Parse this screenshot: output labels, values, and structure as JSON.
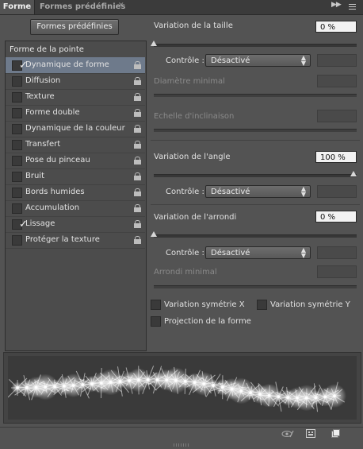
{
  "tabs": {
    "active": "Forme",
    "inactive": "Formes prédéfinies"
  },
  "presets_button": "Formes prédéfinies",
  "brush_tip_header": "Forme de la pointe",
  "list_items": [
    {
      "label": "Dynamique de forme",
      "checked": true,
      "selected": true
    },
    {
      "label": "Diffusion",
      "checked": false,
      "selected": false
    },
    {
      "label": "Texture",
      "checked": false,
      "selected": false
    },
    {
      "label": "Forme double",
      "checked": false,
      "selected": false
    },
    {
      "label": "Dynamique de la couleur",
      "checked": false,
      "selected": false
    },
    {
      "label": "Transfert",
      "checked": false,
      "selected": false
    },
    {
      "label": "Pose du pinceau",
      "checked": false,
      "selected": false
    },
    {
      "label": "Bruit",
      "checked": false,
      "selected": false
    },
    {
      "label": "Bords humides",
      "checked": false,
      "selected": false
    },
    {
      "label": "Accumulation",
      "checked": false,
      "selected": false
    },
    {
      "label": "Lissage",
      "checked": true,
      "selected": false
    },
    {
      "label": "Protéger la texture",
      "checked": false,
      "selected": false
    }
  ],
  "size": {
    "label": "Variation de la taille",
    "value": "0 %",
    "control_label": "Contrôle :",
    "control_value": "Désactivé",
    "min_label": "Diamètre minimal",
    "tilt_label": "Echelle d'inclinaison",
    "slider_fraction": 0.0
  },
  "angle": {
    "label": "Variation de l'angle",
    "value": "100 %",
    "control_label": "Contrôle :",
    "control_value": "Désactivé",
    "slider_fraction": 1.0
  },
  "roundness": {
    "label": "Variation de l'arrondi",
    "value": "0 %",
    "control_label": "Contrôle :",
    "control_value": "Désactivé",
    "min_label": "Arrondi minimal",
    "slider_fraction": 0.0
  },
  "checkboxes": {
    "flip_x": "Variation symétrie X",
    "flip_y": "Variation symétrie Y",
    "projection": "Projection de la forme"
  },
  "icons": {
    "tab_close": "close-icon",
    "collapse": "double-chevron-right-icon",
    "menu": "panel-menu-icon",
    "lock": "lock-icon",
    "eye_brush": "toggle-live-tip-icon",
    "grid": "brush-grid-icon",
    "new": "new-preset-icon"
  }
}
